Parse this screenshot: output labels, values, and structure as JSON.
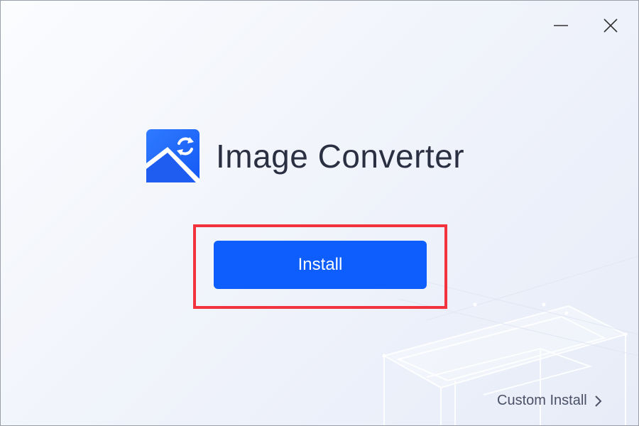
{
  "window": {
    "minimize_icon": "minimize-icon",
    "close_icon": "close-icon"
  },
  "app": {
    "title": "Image Converter",
    "logo_icon": "image-convert-icon"
  },
  "actions": {
    "install_label": "Install",
    "custom_install_label": "Custom Install",
    "custom_install_icon": "chevron-right-icon"
  },
  "colors": {
    "accent": "#0d5efc",
    "highlight": "#f2323c",
    "title_text": "#2a3042"
  }
}
